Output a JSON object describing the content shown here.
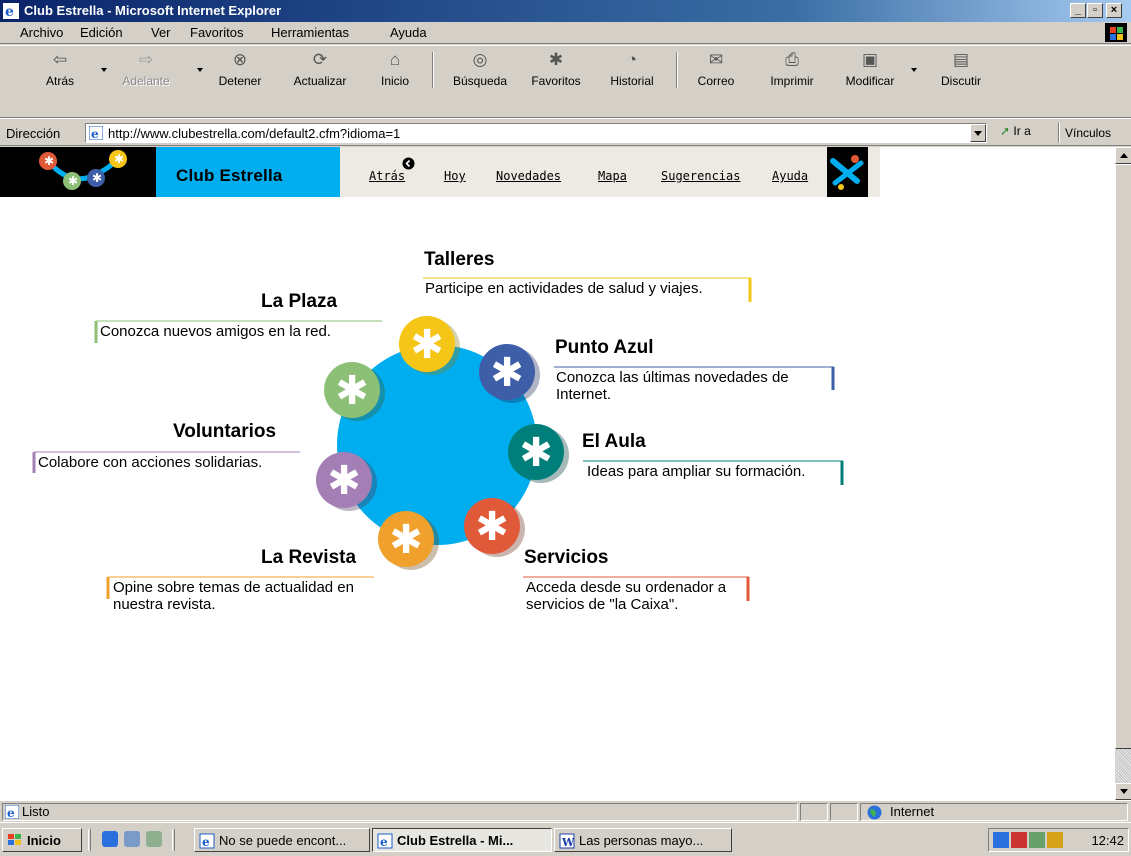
{
  "window": {
    "title": "Club Estrella - Microsoft Internet Explorer",
    "controls": [
      "_",
      "▫",
      "×"
    ]
  },
  "menu": [
    "Archivo",
    "Edición",
    "Ver",
    "Favoritos",
    "Herramientas",
    "Ayuda"
  ],
  "toolbar": {
    "back": "Atrás",
    "forward": "Adelante",
    "stop": "Detener",
    "refresh": "Actualizar",
    "home": "Inicio",
    "search": "Búsqueda",
    "favorites": "Favoritos",
    "history": "Historial",
    "mail": "Correo",
    "print": "Imprimir",
    "edit": "Modificar",
    "discuss": "Discutir"
  },
  "address": {
    "label": "Dirección",
    "url": "http://www.clubestrella.com/default2.cfm?idioma=1",
    "go": "Ir a",
    "links": "Vínculos"
  },
  "site": {
    "brand": "Club Estrella",
    "nav": [
      "Atrás",
      "Hoy",
      "Novedades",
      "Mapa",
      "Sugerencias",
      "Ayuda"
    ],
    "colors": {
      "brand_blue": "#00aeef",
      "circle_blue": "#00aeef"
    }
  },
  "sections": {
    "talleres": {
      "title": "Talleres",
      "desc": "Participe en actividades de salud y viajes.",
      "color": "#f5c518"
    },
    "plaza": {
      "title": "La Plaza",
      "desc": "Conozca nuevos amigos en la red.",
      "color": "#8cc076"
    },
    "punto_azul": {
      "title": "Punto  Azul",
      "desc": "Conozca las últimas novedades de Internet.",
      "color": "#3f5ea8"
    },
    "aula": {
      "title": "El Aula",
      "desc": "Ideas para ampliar su formación.",
      "color": "#007e7a"
    },
    "voluntarios": {
      "title": "Voluntarios",
      "desc": "Colabore con acciones solidarias.",
      "color": "#a47fb5"
    },
    "revista": {
      "title": "La Revista",
      "desc": "Opine sobre temas de actualidad en nuestra revista.",
      "color": "#f0a02c"
    },
    "servicios": {
      "title": "Servicios",
      "desc": "Acceda desde su ordenador a servicios de \"la Caixa\".",
      "color": "#e05a3a"
    }
  },
  "status": {
    "text": "Listo",
    "zone": "Internet"
  },
  "taskbar": {
    "start": "Inicio",
    "tasks": [
      "No se puede encont...",
      "Club Estrella - Mi...",
      "Las personas mayo..."
    ],
    "clock": "12:42"
  }
}
